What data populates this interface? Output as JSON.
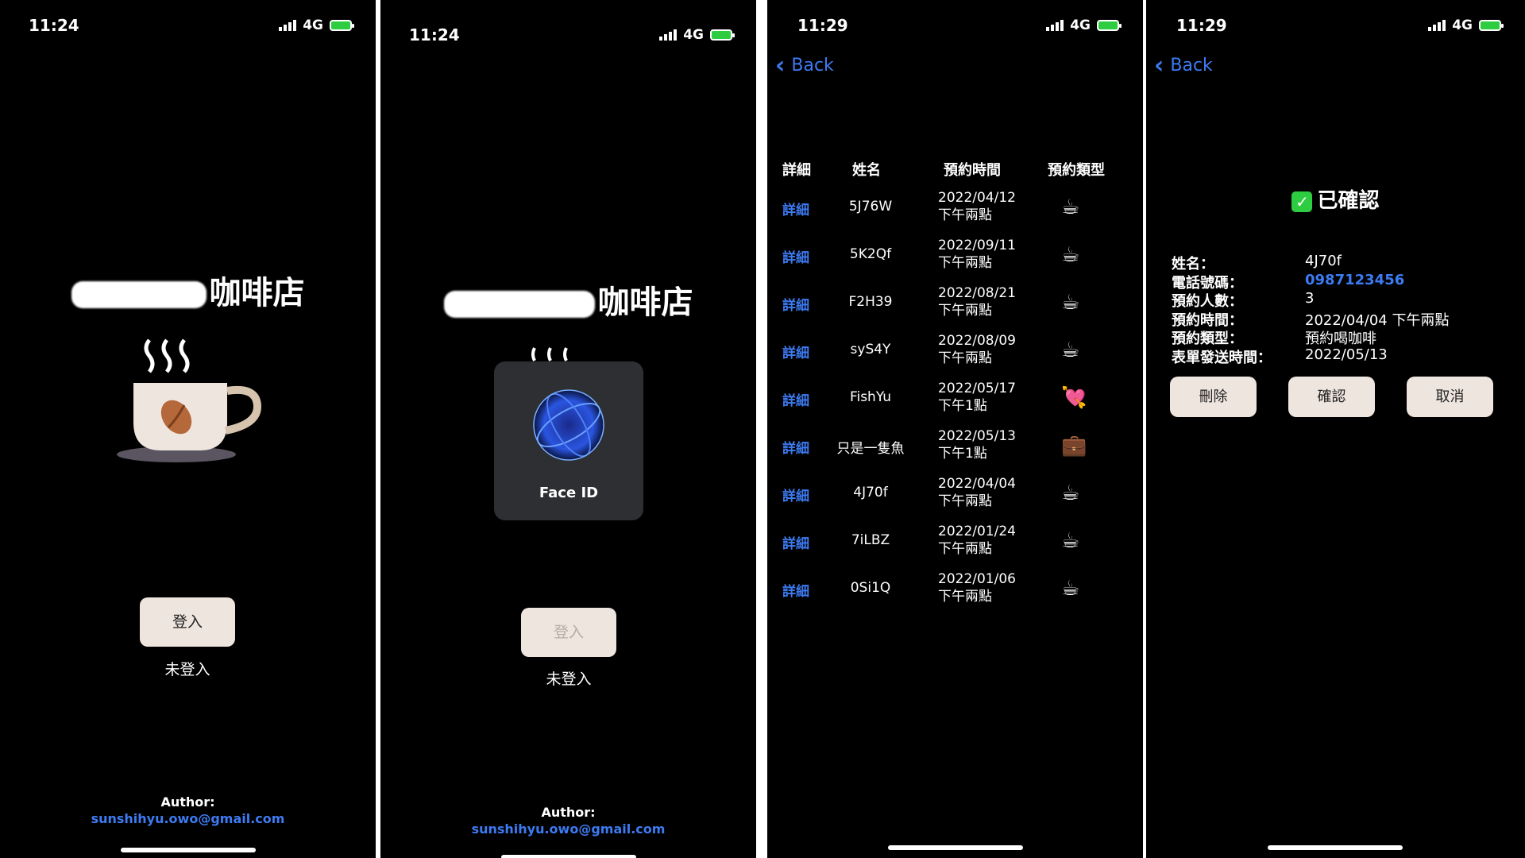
{
  "screens": {
    "login": {
      "time": "11:24",
      "network": "4G",
      "shop_title": "咖啡店",
      "login_button": "登入",
      "status": "未登入",
      "author_label": "Author:",
      "author_email": "sunshihyu.owo@gmail.com"
    },
    "faceid": {
      "time": "11:24",
      "network": "4G",
      "shop_title": "咖啡店",
      "faceid_label": "Face ID",
      "login_button": "登入",
      "status": "未登入",
      "author_label": "Author:",
      "author_email": "sunshihyu.owo@gmail.com"
    },
    "list": {
      "time": "11:29",
      "network": "4G",
      "back_label": "Back",
      "headers": [
        "詳細",
        "姓名",
        "預約時間",
        "預約類型"
      ],
      "rows": [
        {
          "detail": "詳細",
          "name": "5J76W",
          "date": "2022/04/12",
          "period": "下午兩點",
          "type_icon": "☕"
        },
        {
          "detail": "詳細",
          "name": "5K2Qf",
          "date": "2022/09/11",
          "period": "下午兩點",
          "type_icon": "☕"
        },
        {
          "detail": "詳細",
          "name": "F2H39",
          "date": "2022/08/21",
          "period": "下午兩點",
          "type_icon": "☕"
        },
        {
          "detail": "詳細",
          "name": "syS4Y",
          "date": "2022/08/09",
          "period": "下午兩點",
          "type_icon": "☕"
        },
        {
          "detail": "詳細",
          "name": "FishYu",
          "date": "2022/05/17",
          "period": "下午1點",
          "type_icon": "💘"
        },
        {
          "detail": "詳細",
          "name": "只是一隻魚",
          "date": "2022/05/13",
          "period": "下午1點",
          "type_icon": "💼"
        },
        {
          "detail": "詳細",
          "name": "4J70f",
          "date": "2022/04/04",
          "period": "下午兩點",
          "type_icon": "☕"
        },
        {
          "detail": "詳細",
          "name": "7iLBZ",
          "date": "2022/01/24",
          "period": "下午兩點",
          "type_icon": "☕"
        },
        {
          "detail": "詳細",
          "name": "0Si1Q",
          "date": "2022/01/06",
          "period": "下午兩點",
          "type_icon": "☕"
        }
      ]
    },
    "detail": {
      "time": "11:29",
      "network": "4G",
      "back_label": "Back",
      "status_title": "已確認",
      "fields": [
        {
          "label": "姓名：",
          "value": "4J70f"
        },
        {
          "label": "電話號碼：",
          "value": "0987123456"
        },
        {
          "label": "預約人數：",
          "value": "3"
        },
        {
          "label": "預約時間：",
          "value": "2022/04/04 下午兩點"
        },
        {
          "label": "預約類型：",
          "value": "預約喝咖啡"
        },
        {
          "label": "表單發送時間：",
          "value": "2022/05/13"
        }
      ],
      "buttons": {
        "delete": "刪除",
        "confirm": "確認",
        "cancel": "取消"
      }
    }
  },
  "colors": {
    "accent": "#3d7bf2",
    "button_bg": "#efe5df",
    "battery": "#2ecc40"
  }
}
